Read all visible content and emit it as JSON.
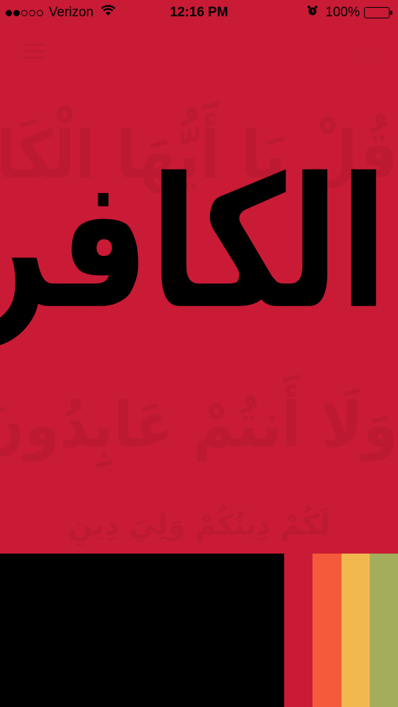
{
  "status_bar": {
    "carrier": "Verizon",
    "signal_dots": [
      true,
      true,
      false,
      false,
      false
    ],
    "time": "12:16 PM",
    "battery_percent": "100%",
    "battery_level": 1.0,
    "icons": {
      "wifi": "wifi-icon",
      "alarm": "alarm-icon",
      "battery": "battery-icon"
    }
  },
  "toolbar": {
    "menu_icon": "hamburger-menu-icon",
    "more_icon": "more-dots-icon",
    "more_glyph": "···"
  },
  "content": {
    "main_word": "الكافرون",
    "ghost_line_1": "قُلْ يَا أَيُّهَا الْكَافِرُونَ",
    "ghost_line_2": "وَلَا أَنتُمْ عَابِدُونَ مَا أَعْبُدُ",
    "ghost_line_3": "لَكُمْ دِينُكُمْ وَلِيَ دِينِ"
  },
  "colors": {
    "main_background": "#C91B36",
    "bottom_background": "#000000",
    "swatches": [
      "#C91B36",
      "#F55A3A",
      "#F0B84E",
      "#A3AD5B"
    ]
  }
}
